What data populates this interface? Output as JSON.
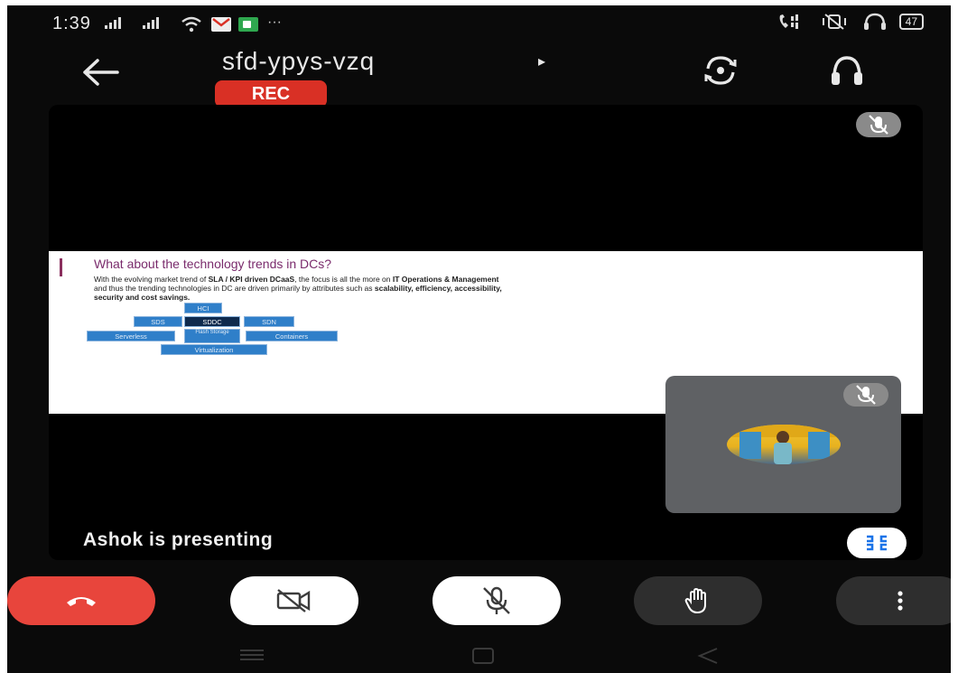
{
  "status_bar": {
    "time": "1:39",
    "more_indicator": "···",
    "battery": "47"
  },
  "header": {
    "meeting_code": "sfd-ypys-vzq",
    "caret": "▸",
    "rec_label": "REC"
  },
  "slide": {
    "title": "What about the technology trends in DCs?",
    "body_line1_a": "With the evolving market trend of ",
    "body_line1_b": "SLA / KPI driven DCaaS",
    "body_line1_c": ", the focus is all the more on ",
    "body_line1_d": "IT Operations & Management",
    "body_line2_a": "and thus the trending technologies in DC are driven primarily by attributes such as ",
    "body_line2_b": "scalability, efficiency, accessibility,",
    "body_line3": "security and cost savings.",
    "tech_boxes": {
      "hci": "HCI",
      "sds": "SDS",
      "sddc": "SDDC",
      "sdn": "SDN",
      "serverless": "Serverless",
      "flash": "Flash Storage",
      "containers": "Containers",
      "virtualization": "Virtualization"
    }
  },
  "presenting_label": "Ashok is presenting",
  "icons": {
    "back": "arrow-left-icon",
    "switch_camera": "switch-camera-icon",
    "audio_output": "headphones-icon",
    "mic_off": "mic-off-icon",
    "fullscreen_exit": "fullscreen-exit-icon",
    "end_call": "phone-hangup-icon",
    "camera_off": "video-off-icon",
    "raise_hand": "hand-icon",
    "more": "more-vertical-icon"
  },
  "colors": {
    "rec_red": "#d93025",
    "end_call_red": "#e8453c",
    "slide_title": "#7a2b6c",
    "tech_blue": "#2f7fc9",
    "tech_dark": "#0f2a4d"
  }
}
